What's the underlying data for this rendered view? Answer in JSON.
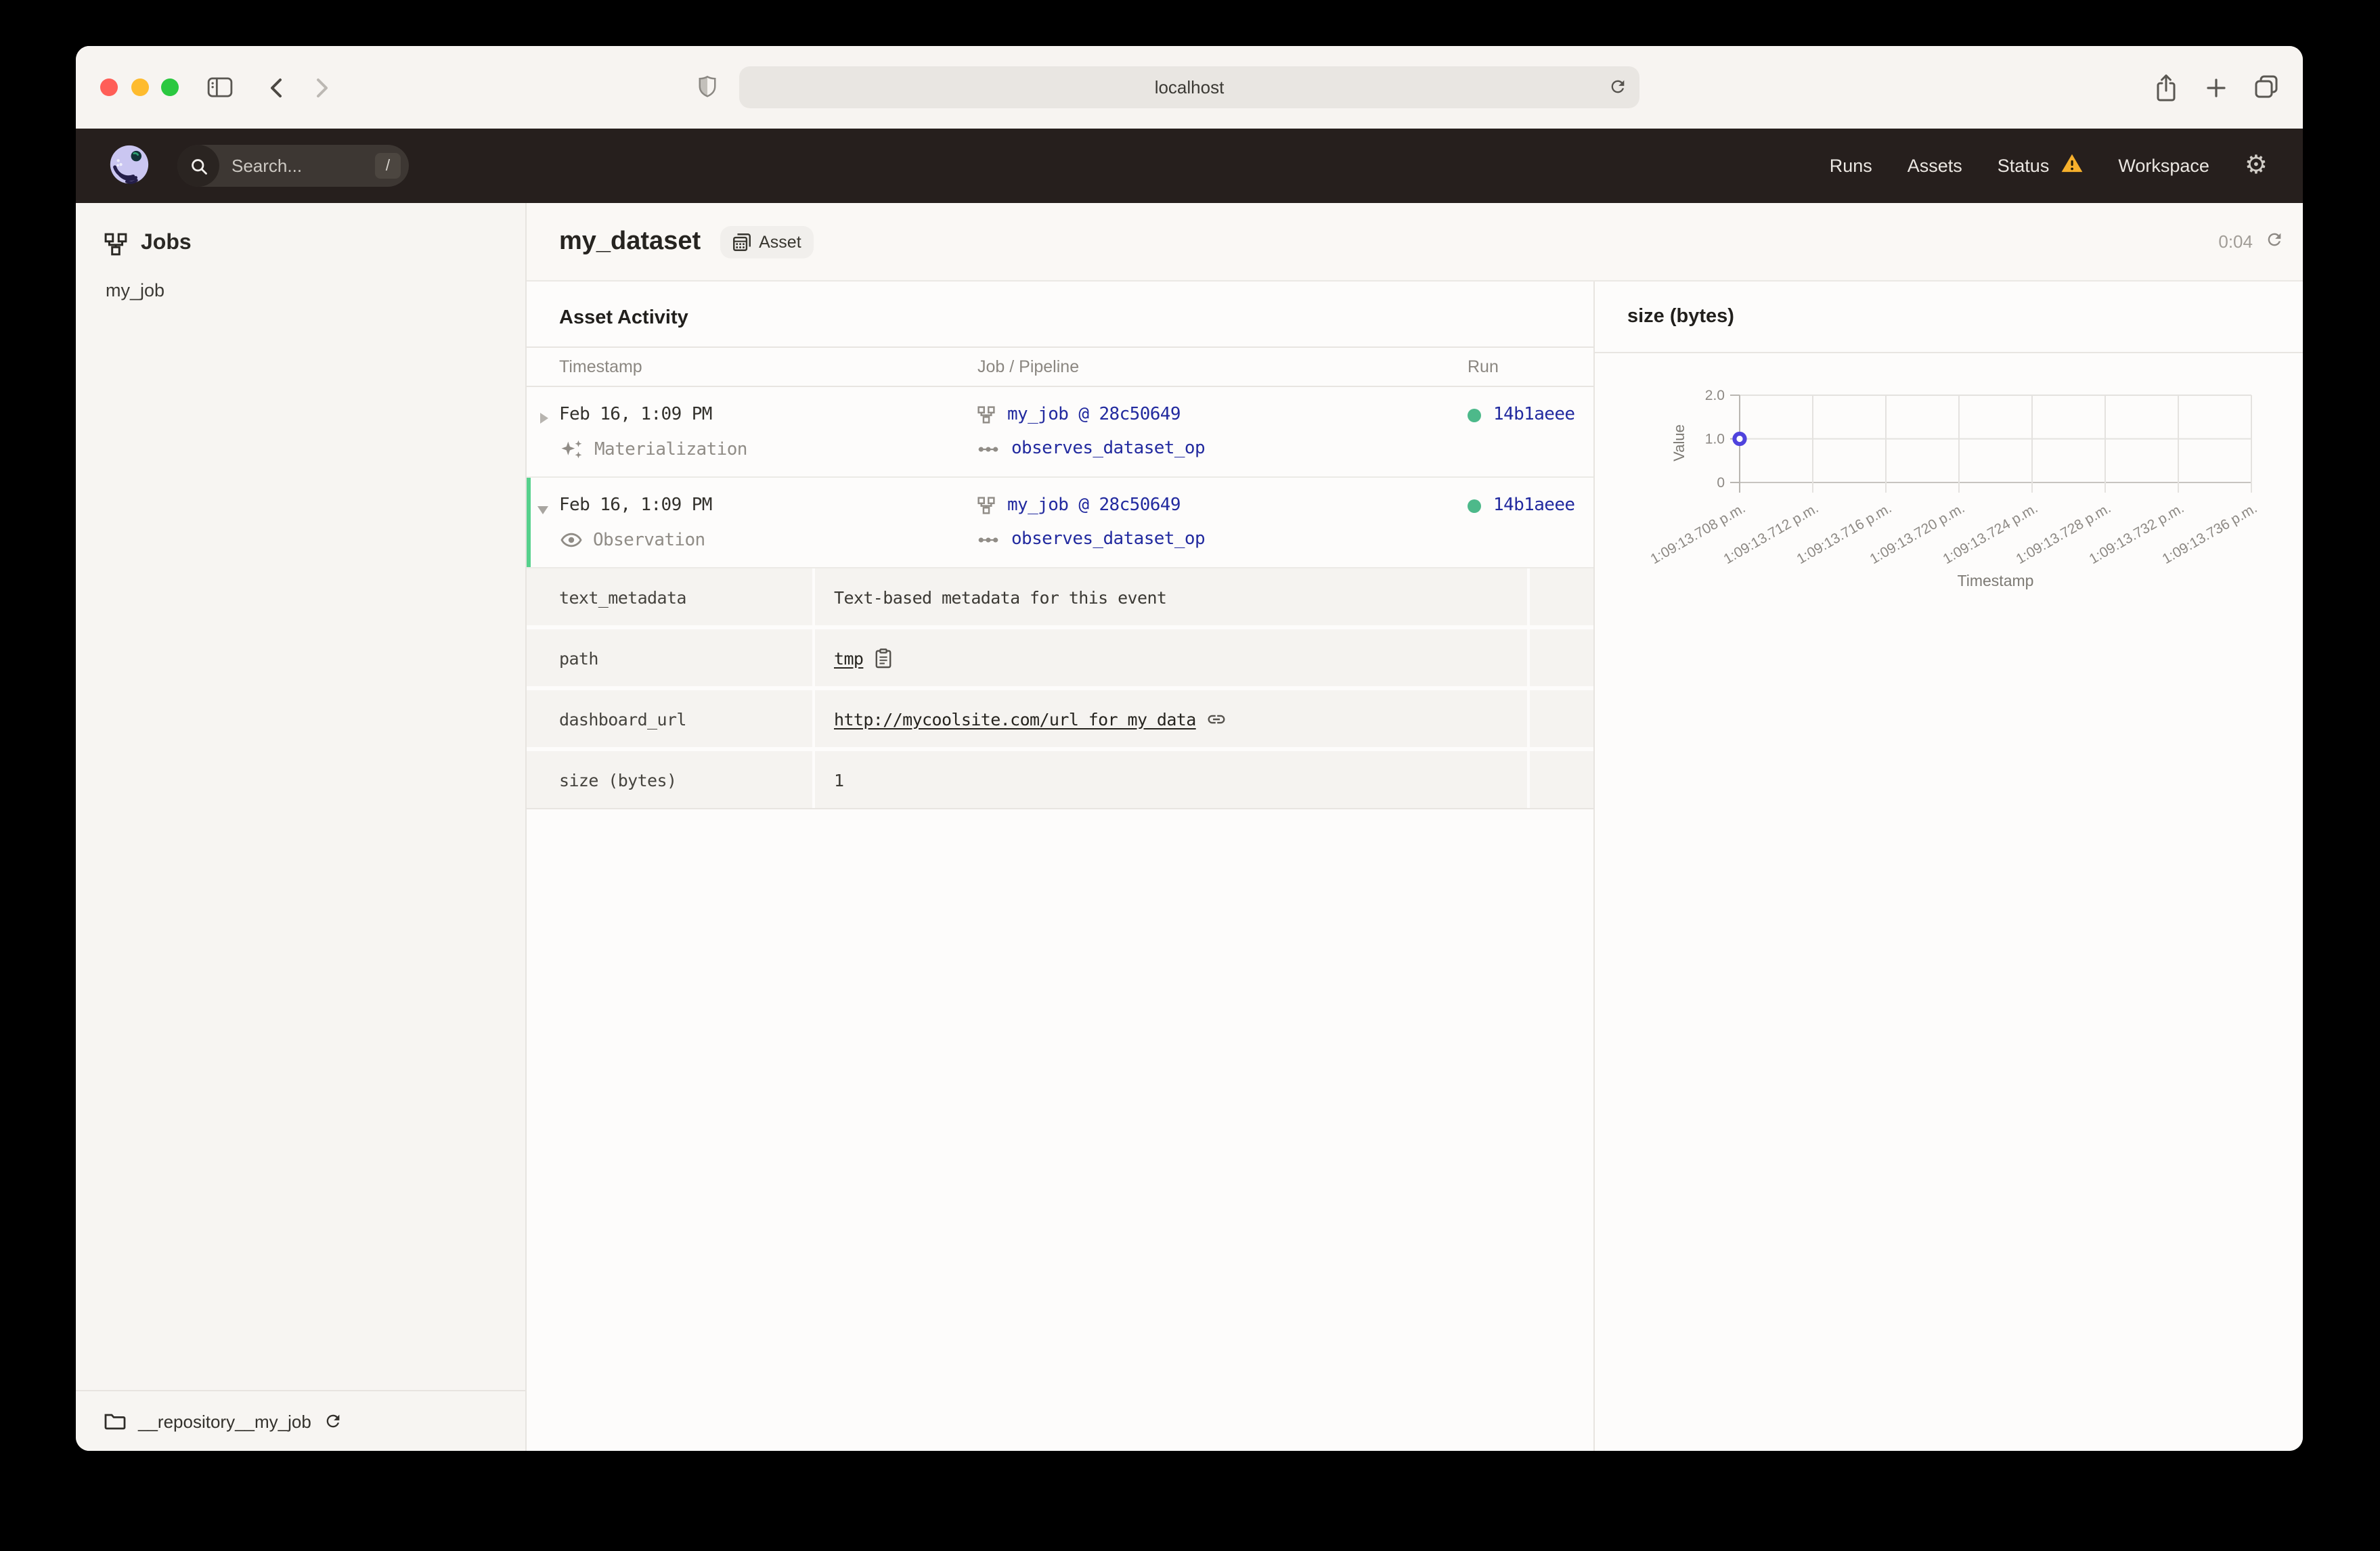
{
  "browser": {
    "url": "localhost"
  },
  "app_header": {
    "search_placeholder": "Search...",
    "search_shortcut": "/",
    "nav": [
      {
        "label": "Runs"
      },
      {
        "label": "Assets"
      },
      {
        "label": "Status"
      },
      {
        "label": "Workspace"
      }
    ]
  },
  "sidebar": {
    "title": "Jobs",
    "items": [
      {
        "label": "my_job"
      }
    ],
    "footer": {
      "repository": "__repository__my_job"
    }
  },
  "page": {
    "title": "my_dataset",
    "badge": "Asset",
    "timer": "0:04"
  },
  "activity": {
    "heading": "Asset Activity",
    "columns": [
      "Timestamp",
      "Job / Pipeline",
      "Run"
    ],
    "events": [
      {
        "timestamp": "Feb 16, 1:09 PM",
        "event_type": "Materialization",
        "job": "my_job @ 28c50649",
        "op": "observes_dataset_op",
        "run_id": "14b1aeee"
      },
      {
        "timestamp": "Feb 16, 1:09 PM",
        "event_type": "Observation",
        "job": "my_job @ 28c50649",
        "op": "observes_dataset_op",
        "run_id": "14b1aeee"
      }
    ],
    "metadata": [
      {
        "key": "text_metadata",
        "value": "Text-based metadata for this event"
      },
      {
        "key": "path",
        "value": "tmp"
      },
      {
        "key": "dashboard_url",
        "value": "http://mycoolsite.com/url_for_my_data"
      },
      {
        "key": "size (bytes)",
        "value": "1"
      }
    ]
  },
  "chart_data": {
    "type": "scatter",
    "title": "size (bytes)",
    "xlabel": "Timestamp",
    "ylabel": "Value",
    "x_tick_labels": [
      "1:09:13.708 p.m.",
      "1:09:13.712 p.m.",
      "1:09:13.716 p.m.",
      "1:09:13.720 p.m.",
      "1:09:13.724 p.m.",
      "1:09:13.728 p.m.",
      "1:09:13.732 p.m.",
      "1:09:13.736 p.m."
    ],
    "y_ticks": [
      "2.0",
      "1.0",
      "0"
    ],
    "ylim": [
      0,
      2
    ],
    "grid": true,
    "legend": false,
    "points": [
      {
        "x": "1:09:13.708 p.m.",
        "y": 1
      }
    ]
  },
  "colors": {
    "link_navy": "#222a9f",
    "run_success_green": "#4db98a",
    "expanded_row_green": "#56d18c",
    "warning_amber": "#f6b02c",
    "chart_point_blurple": "#4f43dd"
  }
}
